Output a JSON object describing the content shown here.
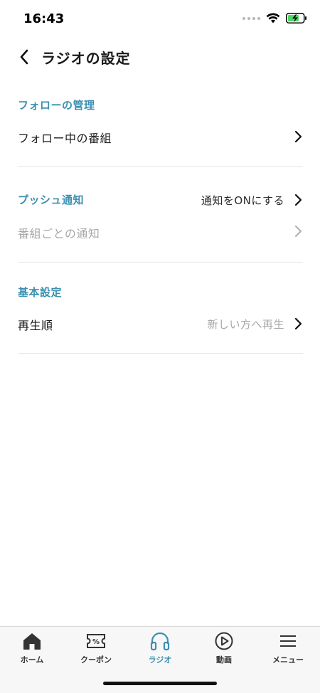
{
  "status_bar": {
    "time": "16:43"
  },
  "header": {
    "title": "ラジオの設定"
  },
  "sections": {
    "follow": {
      "title": "フォローの管理",
      "row_label": "フォロー中の番組"
    },
    "push": {
      "title": "プッシュ通知",
      "value": "通知をONにする",
      "row_label": "番組ごとの通知"
    },
    "basic": {
      "title": "基本設定",
      "row_label": "再生順",
      "row_value": "新しい方へ再生"
    }
  },
  "tabs": [
    {
      "label": "ホーム",
      "icon": "home-icon"
    },
    {
      "label": "クーポン",
      "icon": "coupon-icon"
    },
    {
      "label": "ラジオ",
      "icon": "headphones-icon",
      "active": true
    },
    {
      "label": "動画",
      "icon": "play-circle-icon"
    },
    {
      "label": "メニュー",
      "icon": "menu-icon"
    }
  ],
  "colors": {
    "accent": "#3b8fb1",
    "text": "#1c1c1c",
    "muted": "#a8a8a8",
    "battery": "#4cd964"
  }
}
